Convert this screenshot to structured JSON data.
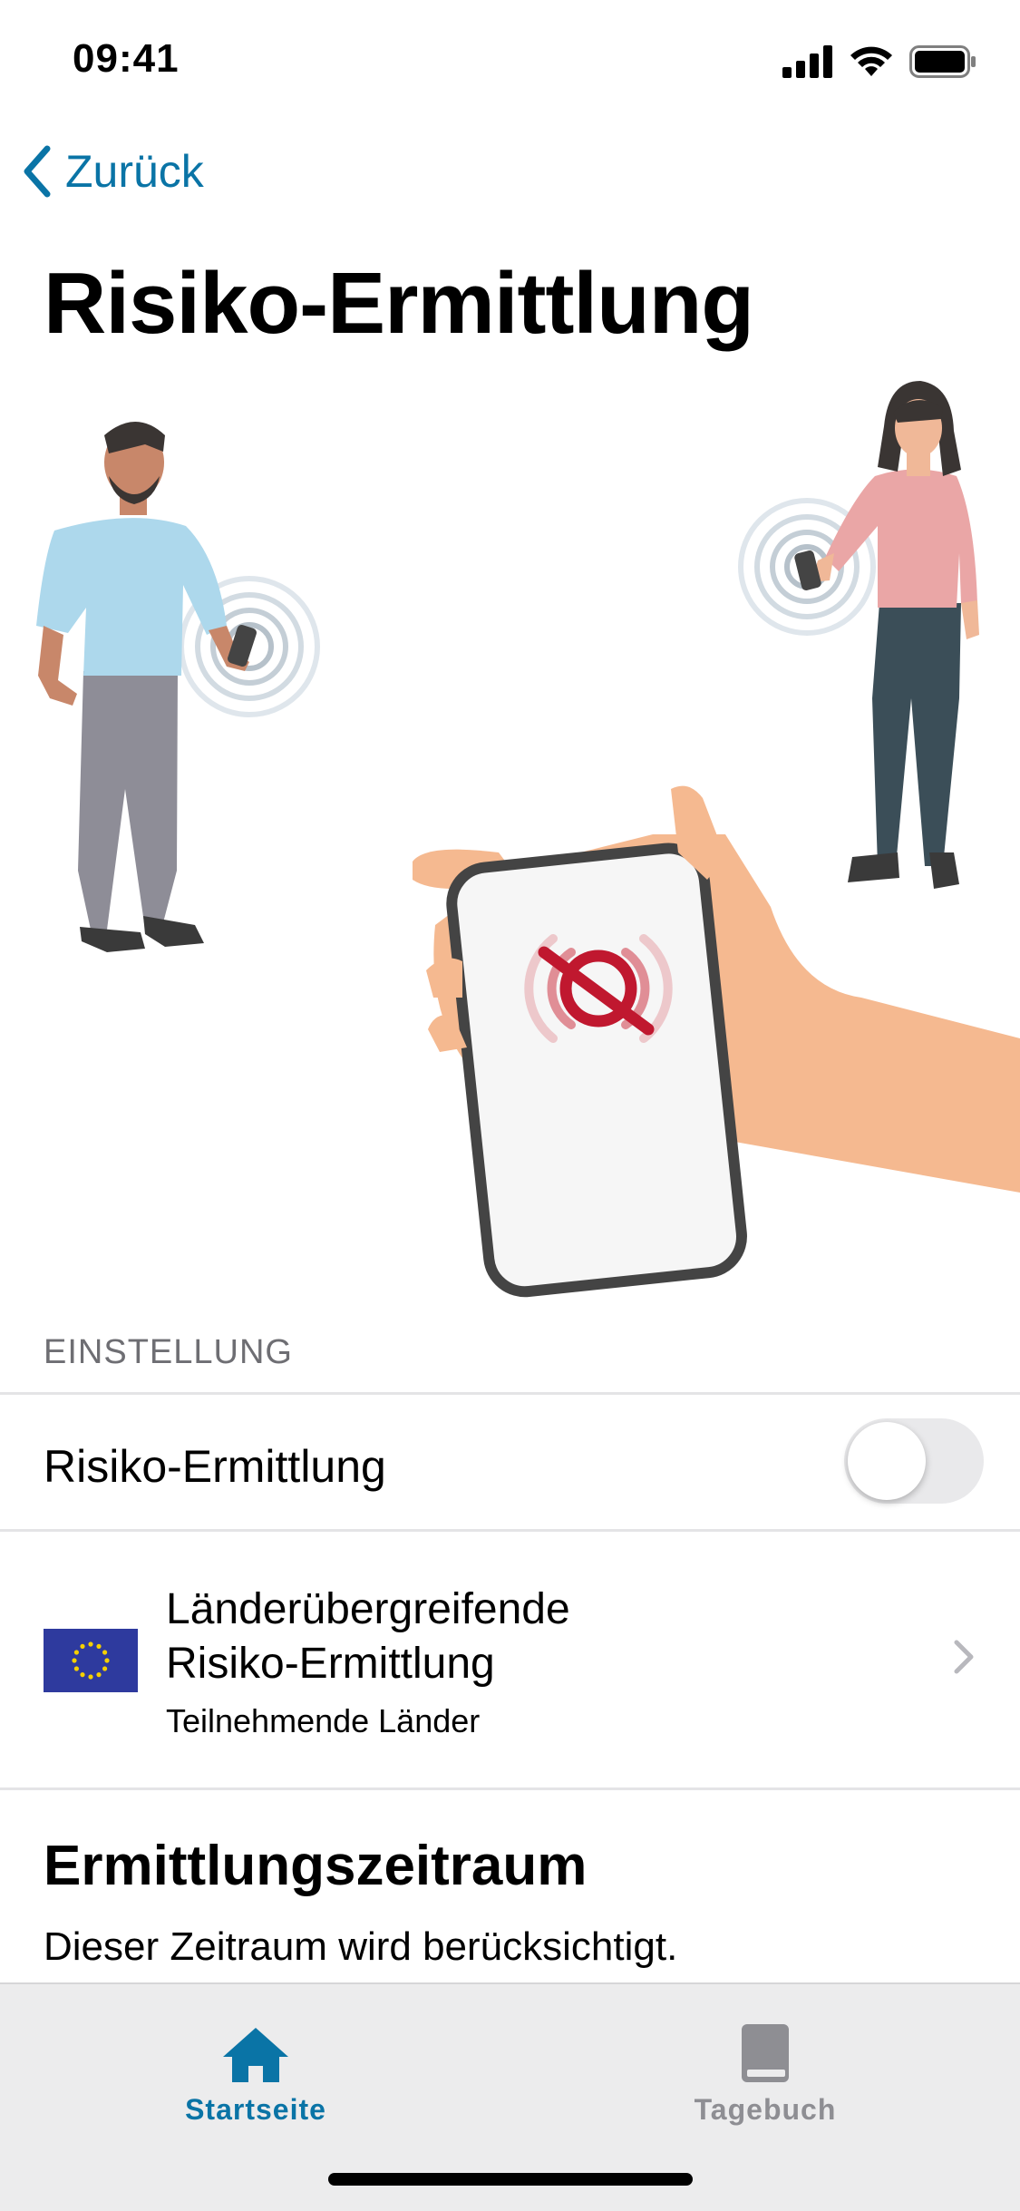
{
  "status_bar": {
    "time": "09:41"
  },
  "nav": {
    "back_label": "Zurück"
  },
  "page": {
    "title": "Risiko-Ermittlung"
  },
  "settings": {
    "section_header": "EINSTELLUNG",
    "risk_toggle": {
      "label": "Risiko-Ermittlung",
      "enabled": false
    },
    "cross_border": {
      "title_line1": "Länderübergreifende",
      "title_line2": "Risiko-Ermittlung",
      "subtitle": "Teilnehmende Länder"
    }
  },
  "period": {
    "heading": "Ermittlungszeitraum",
    "description": "Dieser Zeitraum wird berücksichtigt."
  },
  "tab_bar": {
    "home_label": "Startseite",
    "diary_label": "Tagebuch",
    "active_tab": "home"
  },
  "colors": {
    "accent": "#0a74a6",
    "inactive_tab": "#8e8e93",
    "alert_red": "#c0182f"
  }
}
